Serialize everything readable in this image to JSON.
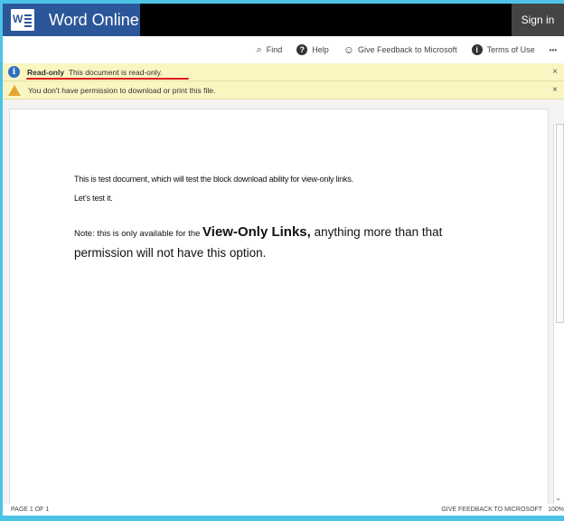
{
  "header": {
    "app_name": "Word Online",
    "sign_in": "Sign in"
  },
  "toolbar": {
    "find": "Find",
    "help": "Help",
    "feedback": "Give Feedback to Microsoft",
    "terms": "Terms of Use",
    "more": "•••"
  },
  "notices": {
    "readonly_label": "Read-only",
    "readonly_text": "This document is read-only.",
    "permission_text": "You don't have permission to download or print this file.",
    "close": "×"
  },
  "document": {
    "line1": "This is test document, which will test the block download ability for view-only links.",
    "line2": "Let’s test it.",
    "note_prefix": "Note: this is only available for the ",
    "note_bold": "View-Only Links,",
    "note_rest": " anything more than that permission will not have this option."
  },
  "status": {
    "page": "PAGE 1 OF 1",
    "feedback": "GIVE FEEDBACK TO MICROSOFT",
    "zoom": "100%"
  }
}
